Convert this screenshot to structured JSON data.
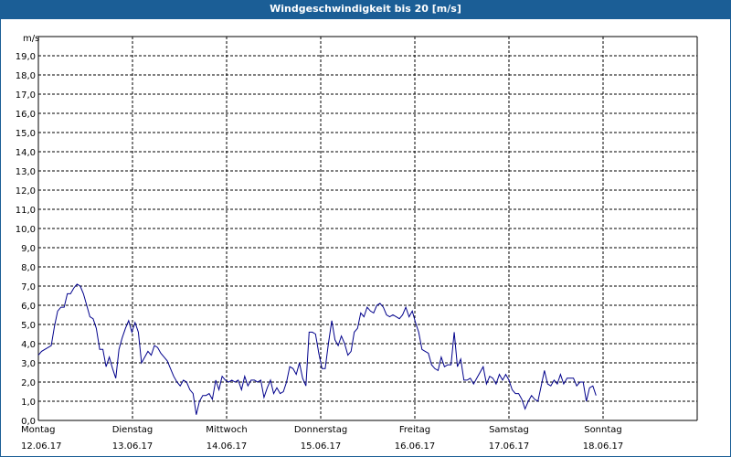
{
  "window": {
    "title": "Windgeschwindigkeit bis 20 [m/s]"
  },
  "chart_data": {
    "type": "line",
    "title": "Windgeschwindigkeit bis 20 [m/s]",
    "ylabel": "m/s",
    "ylim": [
      0,
      20
    ],
    "yticks": [
      "0,0",
      "1,0",
      "2,0",
      "3,0",
      "4,0",
      "5,0",
      "6,0",
      "7,0",
      "8,0",
      "9,0",
      "10,0",
      "11,0",
      "12,0",
      "13,0",
      "14,0",
      "15,0",
      "16,0",
      "17,0",
      "18,0",
      "19,0"
    ],
    "xlim": [
      0,
      7
    ],
    "x_unit": "days since Montag 12.06.17 00:00",
    "day_labels": [
      {
        "day": "Montag",
        "date": "12.06.17"
      },
      {
        "day": "Dienstag",
        "date": "13.06.17"
      },
      {
        "day": "Mittwoch",
        "date": "14.06.17"
      },
      {
        "day": "Donnerstag",
        "date": "15.06.17"
      },
      {
        "day": "Freitag",
        "date": "16.06.17"
      },
      {
        "day": "Samstag",
        "date": "17.06.17"
      },
      {
        "day": "Sonntag",
        "date": "18.06.17"
      }
    ],
    "grid": true,
    "line_color": "#00008b",
    "series": [
      {
        "name": "",
        "values": [
          [
            0.0,
            3.4
          ],
          [
            0.034,
            3.6
          ],
          [
            0.068,
            3.7
          ],
          [
            0.103,
            3.8
          ],
          [
            0.137,
            3.9
          ],
          [
            0.171,
            4.9
          ],
          [
            0.205,
            5.7
          ],
          [
            0.24,
            5.9
          ],
          [
            0.274,
            5.9
          ],
          [
            0.308,
            6.6
          ],
          [
            0.342,
            6.6
          ],
          [
            0.377,
            6.9
          ],
          [
            0.411,
            7.1
          ],
          [
            0.445,
            7.0
          ],
          [
            0.479,
            6.6
          ],
          [
            0.514,
            6.0
          ],
          [
            0.548,
            5.4
          ],
          [
            0.582,
            5.3
          ],
          [
            0.616,
            4.8
          ],
          [
            0.651,
            3.7
          ],
          [
            0.685,
            3.7
          ],
          [
            0.719,
            2.8
          ],
          [
            0.753,
            3.3
          ],
          [
            0.788,
            2.7
          ],
          [
            0.822,
            2.2
          ],
          [
            0.856,
            3.7
          ],
          [
            0.89,
            4.3
          ],
          [
            0.925,
            4.8
          ],
          [
            0.959,
            5.2
          ],
          [
            0.993,
            4.6
          ],
          [
            1.027,
            5.1
          ],
          [
            1.062,
            4.6
          ],
          [
            1.096,
            3.0
          ],
          [
            1.13,
            3.3
          ],
          [
            1.164,
            3.6
          ],
          [
            1.199,
            3.4
          ],
          [
            1.233,
            3.9
          ],
          [
            1.267,
            3.8
          ],
          [
            1.301,
            3.5
          ],
          [
            1.336,
            3.3
          ],
          [
            1.37,
            3.1
          ],
          [
            1.404,
            2.7
          ],
          [
            1.438,
            2.3
          ],
          [
            1.473,
            2.0
          ],
          [
            1.507,
            1.8
          ],
          [
            1.541,
            2.1
          ],
          [
            1.575,
            2.0
          ],
          [
            1.61,
            1.6
          ],
          [
            1.644,
            1.4
          ],
          [
            1.678,
            0.3
          ],
          [
            1.712,
            1.0
          ],
          [
            1.747,
            1.3
          ],
          [
            1.781,
            1.3
          ],
          [
            1.815,
            1.4
          ],
          [
            1.849,
            1.1
          ],
          [
            1.884,
            2.1
          ],
          [
            1.918,
            1.6
          ],
          [
            1.952,
            2.3
          ],
          [
            1.986,
            2.1
          ],
          [
            2.021,
            2.0
          ],
          [
            2.055,
            2.1
          ],
          [
            2.089,
            2.0
          ],
          [
            2.123,
            2.1
          ],
          [
            2.158,
            1.6
          ],
          [
            2.192,
            2.3
          ],
          [
            2.226,
            1.8
          ],
          [
            2.26,
            2.1
          ],
          [
            2.295,
            2.1
          ],
          [
            2.329,
            2.0
          ],
          [
            2.363,
            2.1
          ],
          [
            2.397,
            1.2
          ],
          [
            2.432,
            1.7
          ],
          [
            2.466,
            2.1
          ],
          [
            2.5,
            1.4
          ],
          [
            2.534,
            1.7
          ],
          [
            2.569,
            1.4
          ],
          [
            2.603,
            1.5
          ],
          [
            2.637,
            2.0
          ],
          [
            2.671,
            2.8
          ],
          [
            2.706,
            2.7
          ],
          [
            2.74,
            2.4
          ],
          [
            2.774,
            3.0
          ],
          [
            2.808,
            2.2
          ],
          [
            2.843,
            1.8
          ],
          [
            2.877,
            4.6
          ],
          [
            2.911,
            4.6
          ],
          [
            2.945,
            4.5
          ],
          [
            2.98,
            3.5
          ],
          [
            3.014,
            2.7
          ],
          [
            3.048,
            2.7
          ],
          [
            3.082,
            4.0
          ],
          [
            3.117,
            5.2
          ],
          [
            3.151,
            4.2
          ],
          [
            3.185,
            3.9
          ],
          [
            3.219,
            4.4
          ],
          [
            3.254,
            4.0
          ],
          [
            3.288,
            3.4
          ],
          [
            3.322,
            3.6
          ],
          [
            3.356,
            4.6
          ],
          [
            3.391,
            4.8
          ],
          [
            3.425,
            5.6
          ],
          [
            3.459,
            5.4
          ],
          [
            3.493,
            5.9
          ],
          [
            3.528,
            5.7
          ],
          [
            3.562,
            5.6
          ],
          [
            3.596,
            6.0
          ],
          [
            3.63,
            6.1
          ],
          [
            3.665,
            5.9
          ],
          [
            3.699,
            5.5
          ],
          [
            3.733,
            5.4
          ],
          [
            3.767,
            5.5
          ],
          [
            3.802,
            5.4
          ],
          [
            3.836,
            5.3
          ],
          [
            3.87,
            5.5
          ],
          [
            3.904,
            5.9
          ],
          [
            3.939,
            5.4
          ],
          [
            3.973,
            5.7
          ],
          [
            4.007,
            5.1
          ],
          [
            4.041,
            4.6
          ],
          [
            4.076,
            3.7
          ],
          [
            4.11,
            3.6
          ],
          [
            4.144,
            3.5
          ],
          [
            4.178,
            2.9
          ],
          [
            4.213,
            2.7
          ],
          [
            4.247,
            2.6
          ],
          [
            4.281,
            3.3
          ],
          [
            4.315,
            2.8
          ],
          [
            4.35,
            2.9
          ],
          [
            4.384,
            2.9
          ],
          [
            4.418,
            4.6
          ],
          [
            4.452,
            2.8
          ],
          [
            4.487,
            3.2
          ],
          [
            4.521,
            2.1
          ],
          [
            4.555,
            2.1
          ],
          [
            4.589,
            2.2
          ],
          [
            4.624,
            1.9
          ],
          [
            4.658,
            2.2
          ],
          [
            4.692,
            2.5
          ],
          [
            4.726,
            2.8
          ],
          [
            4.761,
            1.9
          ],
          [
            4.795,
            2.3
          ],
          [
            4.829,
            2.2
          ],
          [
            4.863,
            1.9
          ],
          [
            4.898,
            2.4
          ],
          [
            4.932,
            2.1
          ],
          [
            4.966,
            2.4
          ],
          [
            5.0,
            2.1
          ],
          [
            5.034,
            1.6
          ],
          [
            5.069,
            1.4
          ],
          [
            5.103,
            1.4
          ],
          [
            5.137,
            1.1
          ],
          [
            5.171,
            0.6
          ],
          [
            5.206,
            1.0
          ],
          [
            5.24,
            1.3
          ],
          [
            5.274,
            1.1
          ],
          [
            5.308,
            1.0
          ],
          [
            5.343,
            1.8
          ],
          [
            5.377,
            2.6
          ],
          [
            5.411,
            1.9
          ],
          [
            5.445,
            1.8
          ],
          [
            5.48,
            2.1
          ],
          [
            5.514,
            1.9
          ],
          [
            5.548,
            2.4
          ],
          [
            5.582,
            1.9
          ],
          [
            5.617,
            2.2
          ],
          [
            5.651,
            2.2
          ],
          [
            5.685,
            2.2
          ],
          [
            5.719,
            1.8
          ],
          [
            5.754,
            2.0
          ],
          [
            5.788,
            2.0
          ],
          [
            5.822,
            1.0
          ],
          [
            5.856,
            1.7
          ],
          [
            5.891,
            1.8
          ],
          [
            5.925,
            1.3
          ]
        ]
      }
    ]
  }
}
